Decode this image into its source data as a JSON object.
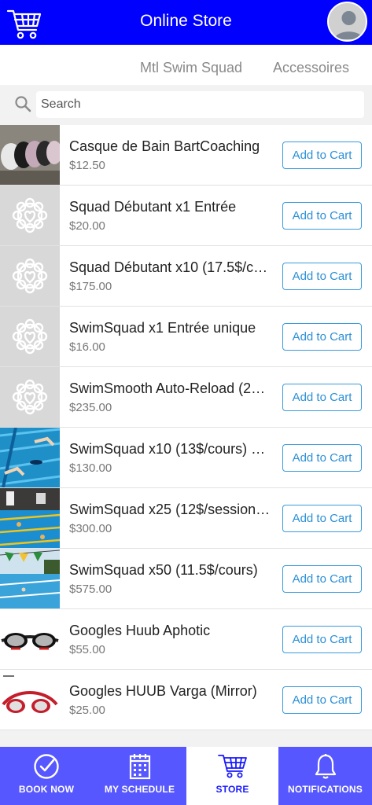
{
  "header": {
    "title": "Online Store",
    "cart_icon": "cart-icon",
    "avatar_icon": "user-avatar-icon"
  },
  "tabs": [
    {
      "label": "Mtl Swim Squad"
    },
    {
      "label": "Accessoires"
    }
  ],
  "search": {
    "placeholder": "Search",
    "value": ""
  },
  "products": [
    {
      "name": "Casque de Bain BartCoaching",
      "price": "$12.50",
      "button": "Add to Cart",
      "image": "swim-caps"
    },
    {
      "name": "Squad Débutant x1 Entrée",
      "price": "$20.00",
      "button": "Add to Cart",
      "image": "placeholder-logo"
    },
    {
      "name": "Squad Débutant x10 (17.5$/c…",
      "price": "$175.00",
      "button": "Add to Cart",
      "image": "placeholder-logo"
    },
    {
      "name": "SwimSquad x1 Entrée unique",
      "price": "$16.00",
      "button": "Add to Cart",
      "image": "placeholder-logo"
    },
    {
      "name": "SwimSmooth Auto-Reload (2…",
      "price": "$235.00",
      "button": "Add to Cart",
      "image": "placeholder-logo"
    },
    {
      "name": "SwimSquad x10 (13$/cours) …",
      "price": "$130.00",
      "button": "Add to Cart",
      "image": "pool-swimmers"
    },
    {
      "name": "SwimSquad x25 (12$/session…",
      "price": "$300.00",
      "button": "Add to Cart",
      "image": "pool-indoor"
    },
    {
      "name": "SwimSquad x50 (11.5$/cours)",
      "price": "$575.00",
      "button": "Add to Cart",
      "image": "pool-outdoor"
    },
    {
      "name": "Googles Huub Aphotic",
      "price": "$55.00",
      "button": "Add to Cart",
      "image": "goggles-black"
    },
    {
      "name": "Googles HUUB Varga (Mirror)",
      "price": "$25.00",
      "button": "Add to Cart",
      "image": "goggles-red"
    }
  ],
  "bottom_nav": [
    {
      "label": "BOOK NOW",
      "icon": "check-circle-icon",
      "active": false
    },
    {
      "label": "MY SCHEDULE",
      "icon": "calendar-icon",
      "active": false
    },
    {
      "label": "STORE",
      "icon": "cart-icon",
      "active": true
    },
    {
      "label": "NOTIFICATIONS",
      "icon": "bell-icon",
      "active": false
    }
  ],
  "colors": {
    "header": "#0000ff",
    "bottom_nav": "#5757ff",
    "active_nav_text": "#1a1aff",
    "button_border": "#3a9bdc"
  }
}
